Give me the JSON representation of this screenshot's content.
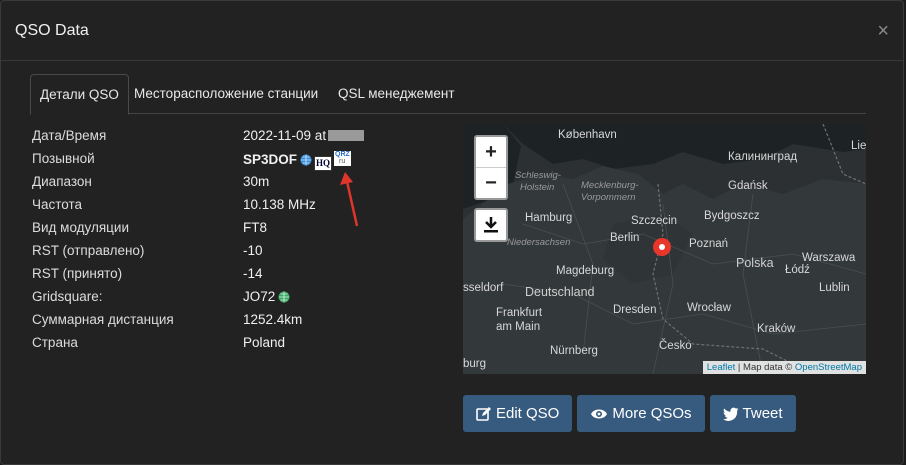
{
  "modal": {
    "title": "QSO Data",
    "close": "×"
  },
  "tabs": [
    {
      "label": "Детали QSO",
      "active": true
    },
    {
      "label": "Месторасположение станции",
      "active": false
    },
    {
      "label": "QSL менеджемент",
      "active": false
    }
  ],
  "details": [
    {
      "label": "Дата/Время",
      "value": "2022-11-09 at"
    },
    {
      "label": "Позывной",
      "value": "SP3DOF"
    },
    {
      "label": "Диапазон",
      "value": "30m"
    },
    {
      "label": "Частота",
      "value": "10.138 MHz"
    },
    {
      "label": "Вид модуляции",
      "value": "FT8"
    },
    {
      "label": "RST (отправлено)",
      "value": "-10"
    },
    {
      "label": "RST (принято)",
      "value": "-14"
    },
    {
      "label": "Gridsquare:",
      "value": "JO72"
    },
    {
      "label": "Суммарная дистанция",
      "value": "1252.4km"
    },
    {
      "label": "Страна",
      "value": "Poland"
    }
  ],
  "icons": {
    "hamqth": "HQ",
    "qrz_top": "QRZ",
    "qrz_bottom": "ru"
  },
  "map": {
    "zoom_in": "+",
    "zoom_out": "−",
    "labels": {
      "kobenhavn": "København",
      "kaliningrad": "Калининград",
      "gdansk": "Gdańsk",
      "schleswig": "Schleswig-",
      "holstein": "Holstein",
      "mecklenburg": "Mecklenburg-",
      "vorpommern": "Vorpommern",
      "hamburg": "Hamburg",
      "szczecin": "Szczecin",
      "bydgoszcz": "Bydgoszcz",
      "niedersachsen": "Niedersachsen",
      "berlin": "Berlin",
      "poznan": "Poznań",
      "warszawa": "Warszawa",
      "polska": "Polska",
      "magdeburg": "Magdeburg",
      "lodz": "Łódź",
      "lublin": "Lublin",
      "deutschland": "Deutschland",
      "usselsdorf": "sseldorf",
      "frankfurt": "Frankfurt",
      "am_main": "am Main",
      "dresden": "Dresden",
      "wroclaw": "Wrocław",
      "krakow": "Kraków",
      "nurnberg": "Nürnberg",
      "cesko": "Česko",
      "burg": "burg",
      "lie": "Lie"
    },
    "attribution": {
      "leaflet": "Leaflet",
      "sep": " | Map data © ",
      "osm": "OpenStreetMap"
    }
  },
  "actions": [
    {
      "label": "Edit QSO"
    },
    {
      "label": "More QSOs"
    },
    {
      "label": "Tweet"
    }
  ],
  "colors": {
    "primary_button": "#375a7f",
    "marker": "#e8362b",
    "annotation_arrow": "#e0352b"
  }
}
